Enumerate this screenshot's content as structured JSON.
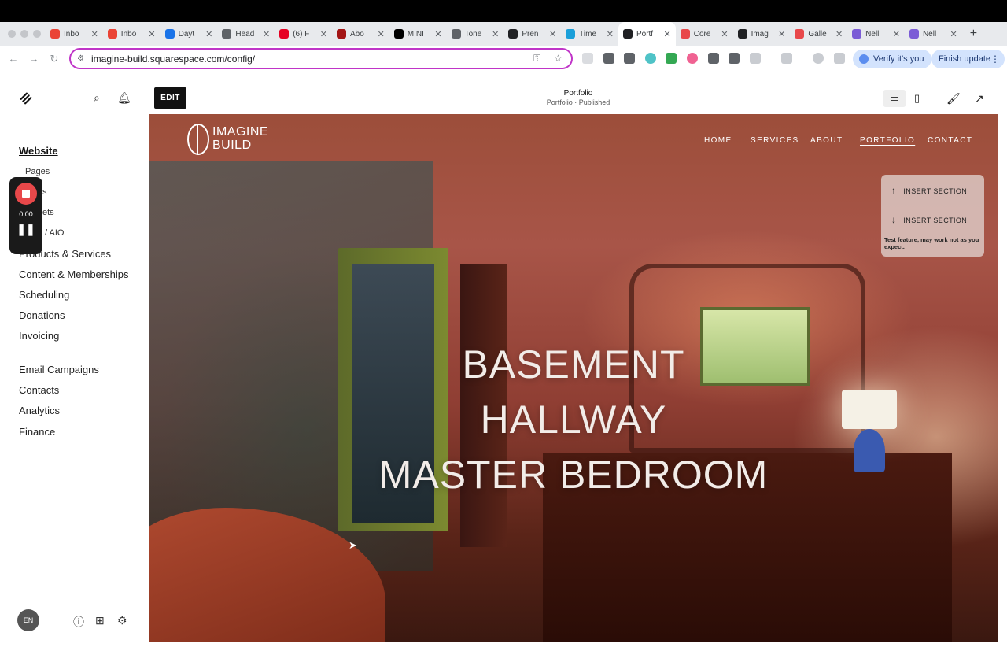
{
  "browser": {
    "tabs": [
      {
        "title": "Inbo",
        "favicon_color": "#ea4335"
      },
      {
        "title": "Inbo",
        "favicon_color": "#ea4335"
      },
      {
        "title": "Dayt",
        "favicon_color": "#1a73e8"
      },
      {
        "title": "Head",
        "favicon_color": "#5f6368"
      },
      {
        "title": "(6) F",
        "favicon_color": "#e60023"
      },
      {
        "title": "Abo",
        "favicon_color": "#a31515"
      },
      {
        "title": "MINI",
        "favicon_color": "#000000"
      },
      {
        "title": "Tone",
        "favicon_color": "#5f6368"
      },
      {
        "title": "Pren",
        "favicon_color": "#202124"
      },
      {
        "title": "Time",
        "favicon_color": "#1a9fd9"
      },
      {
        "title": "Portf",
        "favicon_color": "#202124",
        "active": true
      },
      {
        "title": "Core",
        "favicon_color": "#e8484a"
      },
      {
        "title": "Imag",
        "favicon_color": "#202124"
      },
      {
        "title": "Galle",
        "favicon_color": "#e8484a"
      },
      {
        "title": "Nell",
        "favicon_color": "#7b5cd6"
      },
      {
        "title": "Nell",
        "favicon_color": "#7b5cd6"
      }
    ],
    "new_tab": "+",
    "url": "imagine-build.squarespace.com/config/",
    "verify_label": "Verify it's you",
    "finish_update_label": "Finish update",
    "accent_color": "#c035c8"
  },
  "sidebar": {
    "section_title": "Website",
    "sub_items": [
      "Pages",
      "s",
      "ets",
      "/ AIO"
    ],
    "items": [
      "Products & Services",
      "Content & Memberships",
      "Scheduling",
      "Donations",
      "Invoicing"
    ],
    "items2": [
      "Email Campaigns",
      "Contacts",
      "Analytics",
      "Finance"
    ],
    "avatar_initials": "EN"
  },
  "recorder": {
    "time": "0:00"
  },
  "editor": {
    "edit_label": "EDIT",
    "page_title": "Portfolio",
    "page_status": "Portfolio · Published"
  },
  "site": {
    "logo_line1": "IMAGINE",
    "logo_line2": "BUILD",
    "nav": [
      "HOME",
      "SERVICES",
      "ABOUT",
      "PORTFOLIO",
      "CONTACT"
    ],
    "active_nav": "PORTFOLIO",
    "hero_lines": [
      "BASEMENT",
      "HALLWAY",
      "MASTER BEDROOM"
    ]
  },
  "insert_panel": {
    "insert_above": "INSERT SECTION",
    "insert_below": "INSERT SECTION",
    "note": "Test feature, may work not as you expect."
  }
}
